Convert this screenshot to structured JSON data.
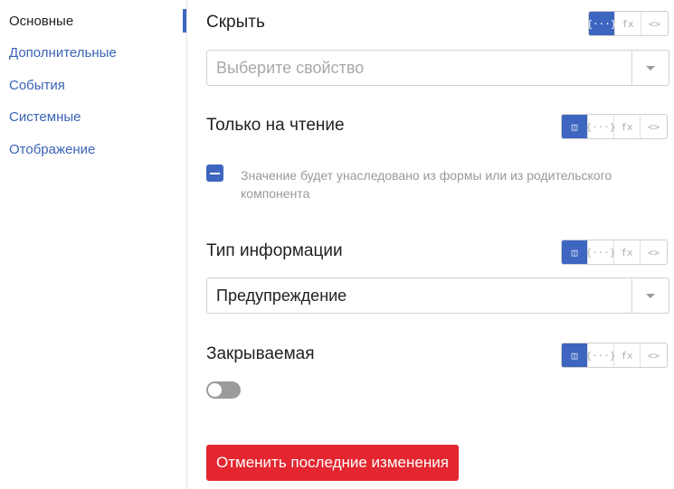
{
  "sidebar": {
    "items": [
      {
        "label": "Основные"
      },
      {
        "label": "Дополнительные"
      },
      {
        "label": "События"
      },
      {
        "label": "Системные"
      },
      {
        "label": "Отображение"
      }
    ]
  },
  "fields": {
    "hide": {
      "title": "Скрыть",
      "select_placeholder": "Выберите свойство",
      "buttons": [
        "{···}",
        "fx",
        "<>"
      ]
    },
    "readonly": {
      "title": "Только на чтение",
      "hint": "Значение будет унаследовано из формы или из родительского компонента",
      "buttons": [
        "◫",
        "{···}",
        "fx",
        "<>"
      ]
    },
    "info_type": {
      "title": "Тип информации",
      "select_value": "Предупреждение",
      "buttons": [
        "◫",
        "{···}",
        "fx",
        "<>"
      ]
    },
    "closable": {
      "title": "Закрываемая",
      "buttons": [
        "◫",
        "{···}",
        "fx",
        "<>"
      ]
    }
  },
  "revert_button": {
    "label": "Отменить последние изменения"
  },
  "colors": {
    "accent": "#3e66c0",
    "danger": "#e3262f",
    "link": "#3b63b6"
  }
}
